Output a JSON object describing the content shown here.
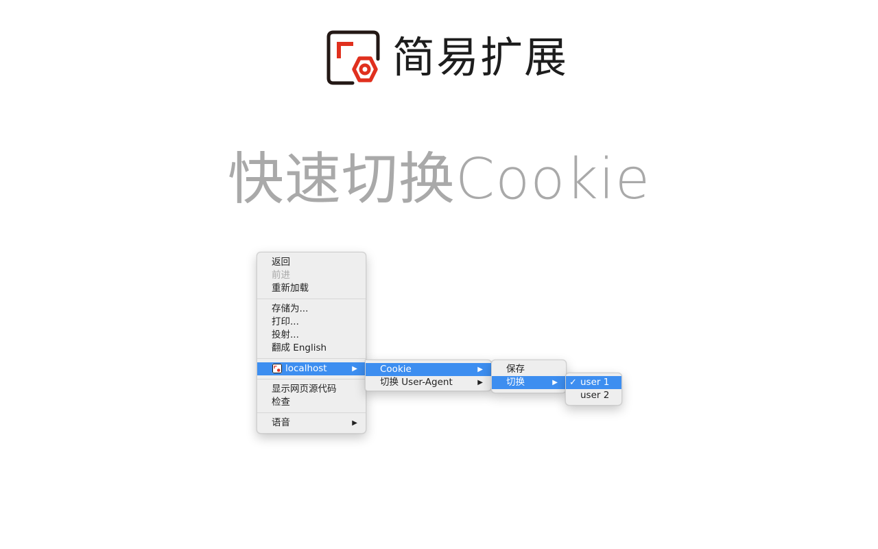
{
  "brand": {
    "name": "简易扩展",
    "logo_icon": "extension-logo-icon"
  },
  "headline": "快速切换Cookie",
  "context_menu": {
    "items_group1": [
      {
        "label": "返回",
        "disabled": false
      },
      {
        "label": "前进",
        "disabled": true
      },
      {
        "label": "重新加载",
        "disabled": false
      }
    ],
    "items_group2": [
      {
        "label": "存储为..."
      },
      {
        "label": "打印..."
      },
      {
        "label": "投射..."
      },
      {
        "label": "翻成 English"
      }
    ],
    "extension_item": {
      "label": "localhost",
      "icon": "extension-favicon-icon",
      "arrow": "▶"
    },
    "items_group4": [
      {
        "label": "显示网页源代码"
      },
      {
        "label": "检查"
      }
    ],
    "speech_item": {
      "label": "语音",
      "arrow": "▶"
    }
  },
  "extension_submenu": {
    "items": [
      {
        "label": "Cookie",
        "arrow": "▶"
      },
      {
        "label": "切换 User-Agent",
        "arrow": "▶"
      }
    ]
  },
  "cookie_submenu": {
    "items": [
      {
        "label": "保存"
      },
      {
        "label": "切换",
        "arrow": "▶"
      }
    ]
  },
  "user_submenu": {
    "check": "✓",
    "items": [
      {
        "label": "user 1",
        "checked": true
      },
      {
        "label": "user 2",
        "checked": false
      }
    ]
  },
  "colors": {
    "selection": "#3d8ef0",
    "logo_red": "#e0301e",
    "logo_dark": "#231815",
    "headline": "#a9a9a9"
  }
}
